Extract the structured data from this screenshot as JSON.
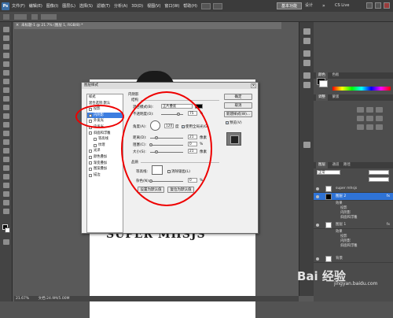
{
  "menubar": {
    "logo": "Ps",
    "items": [
      "文件(F)",
      "编辑(E)",
      "图像(I)",
      "图层(L)",
      "选择(S)",
      "滤镜(T)",
      "分析(A)",
      "3D(D)",
      "视图(V)",
      "窗口(W)",
      "帮助(H)"
    ],
    "workspace": "基本功能",
    "design": "设计",
    "more": "»",
    "cslive": "CS Live"
  },
  "document": {
    "tab": "未标题-1 @ 21.7% (图层 1, RGB/8) *",
    "page_text": "SUPER MHSJS"
  },
  "statusbar": {
    "zoom": "21.67%",
    "doc": "文档:24.9M/5.00M"
  },
  "dialog": {
    "title": "图层样式",
    "styles": [
      {
        "label": "样式",
        "checkbox": false,
        "selected": false
      },
      {
        "label": "混合选项:默认",
        "checkbox": false,
        "selected": false
      },
      {
        "label": "投影",
        "checkbox": true,
        "selected": false
      },
      {
        "label": "内阴影",
        "checkbox": true,
        "selected": true
      },
      {
        "label": "外发光",
        "checkbox": true,
        "selected": false
      },
      {
        "label": "内发光",
        "checkbox": true,
        "selected": false
      },
      {
        "label": "斜面和浮雕",
        "checkbox": true,
        "selected": false
      },
      {
        "label": "等高线",
        "checkbox": true,
        "selected": false
      },
      {
        "label": "纹理",
        "checkbox": true,
        "selected": false
      },
      {
        "label": "光泽",
        "checkbox": true,
        "selected": false
      },
      {
        "label": "颜色叠加",
        "checkbox": true,
        "selected": false
      },
      {
        "label": "渐变叠加",
        "checkbox": true,
        "selected": false
      },
      {
        "label": "图案叠加",
        "checkbox": true,
        "selected": false
      },
      {
        "label": "描边",
        "checkbox": true,
        "selected": false
      }
    ],
    "section_title": "内阴影",
    "structure_title": "结构",
    "blend_mode_label": "混合模式(B):",
    "blend_mode": "正片叠底",
    "opacity_label": "不透明度(O):",
    "opacity": "75",
    "angle_label": "角度(A):",
    "angle": "120",
    "angle_unit": "度",
    "global_light": "使用全局光(G)",
    "distance_label": "距离(D):",
    "distance": "21",
    "choke_label": "阻塞(C):",
    "choke": "0",
    "size_label": "大小(S):",
    "size": "21",
    "px": "像素",
    "pct": "%",
    "quality_title": "品质",
    "contour_label": "等高线:",
    "antialias": "消除锯齿(L)",
    "noise_label": "杂色(N):",
    "noise": "0",
    "set_default": "设置为默认值",
    "reset_default": "复位为默认值",
    "ok": "确定",
    "cancel": "取消",
    "new_style": "新建样式(W)...",
    "preview": "预览(V)"
  },
  "panels": {
    "color_tabs": [
      "颜色",
      "色板"
    ],
    "adjust_tabs": [
      "调整",
      "蒙版"
    ],
    "layers_tabs": [
      "图层",
      "通道",
      "路径"
    ],
    "blend": "正常",
    "layers": [
      {
        "name": "super mhsjs",
        "selected": false,
        "fx": false
      },
      {
        "name": "图层 2",
        "selected": true,
        "fx": true
      },
      {
        "name": "效果",
        "sub": true
      },
      {
        "name": "投影",
        "sub2": true
      },
      {
        "name": "内阴影",
        "sub2": true
      },
      {
        "name": "斜面和浮雕",
        "sub2": true
      },
      {
        "name": "图层 1",
        "selected": false,
        "fx": true
      },
      {
        "name": "效果",
        "sub": true
      },
      {
        "name": "投影",
        "sub2": true
      },
      {
        "name": "内阴影",
        "sub2": true
      },
      {
        "name": "斜面和浮雕",
        "sub2": true
      },
      {
        "name": "背景",
        "selected": false,
        "fx": false
      }
    ]
  },
  "watermark": {
    "main": "Bai 经验",
    "sub": "jingyan.baidu.com"
  },
  "colors": {
    "selected_style": "#3d7ee0",
    "annotation": "#e00000",
    "layer_selected": "#2f73d6"
  }
}
